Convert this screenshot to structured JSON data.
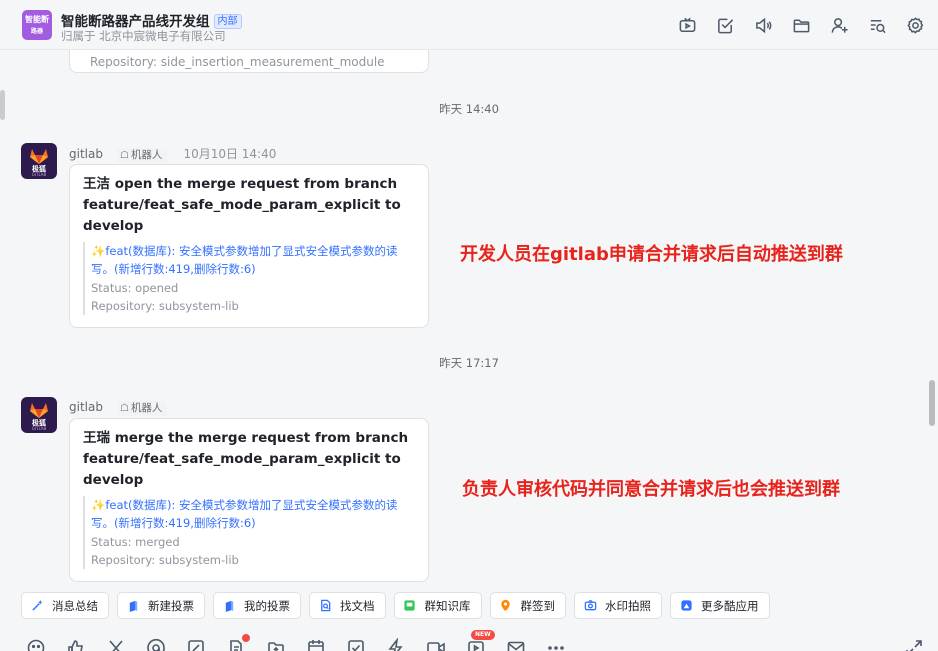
{
  "header": {
    "group_avatar_line1": "智能断",
    "group_avatar_line2": "路器",
    "group_name": "智能断路器产品线开发组",
    "internal_badge": "内部",
    "belongs_to": "归属于 北京中宸微电子有限公司",
    "icons": [
      "tv-icon",
      "task-check-icon",
      "announcement-icon",
      "folder-icon",
      "add-member-icon",
      "search-history-icon",
      "settings-icon"
    ]
  },
  "chat": {
    "prev_card_repo": "Repository: side_insertion_measurement_module",
    "messages": [
      {
        "time_separator": "昨天 14:40",
        "sender": "gitlab",
        "robot_tag": "机器人",
        "sent_time": "10月10日 14:40",
        "avatar_brand": "极狐",
        "avatar_brand_sub": "GITLAB",
        "title": "王洁 open the merge request from branch feature/feat_safe_mode_param_explicit to develop",
        "commit": "✨feat(数据库): 安全模式参数增加了显式安全模式参数的读写。(新增行数:419,删除行数:6)",
        "status": "Status: opened",
        "repo": "Repository: subsystem-lib",
        "annotation": "开发人员在gitlab申请合并请求后自动推送到群"
      },
      {
        "time_separator": "昨天 17:17",
        "sender": "gitlab",
        "robot_tag": "机器人",
        "sent_time": "",
        "avatar_brand": "极狐",
        "avatar_brand_sub": "GITLAB",
        "title": "王瑞 merge the merge request from branch feature/feat_safe_mode_param_explicit to develop",
        "commit": "✨feat(数据库): 安全模式参数增加了显式安全模式参数的读写。(新增行数:419,删除行数:6)",
        "status": "Status: merged",
        "repo": "Repository: subsystem-lib",
        "annotation": "负责人审核代码并同意合并请求后也会推送到群"
      }
    ]
  },
  "quick_actions": [
    "消息总结",
    "新建投票",
    "我的投票",
    "找文档",
    "群知识库",
    "群签到",
    "水印拍照",
    "更多酷应用"
  ],
  "toolbar": {
    "new_badge": "NEW"
  },
  "colors": {
    "accent": "#3370ff",
    "annotation": "#e8231c",
    "group_avatar": "#a15ce0"
  }
}
